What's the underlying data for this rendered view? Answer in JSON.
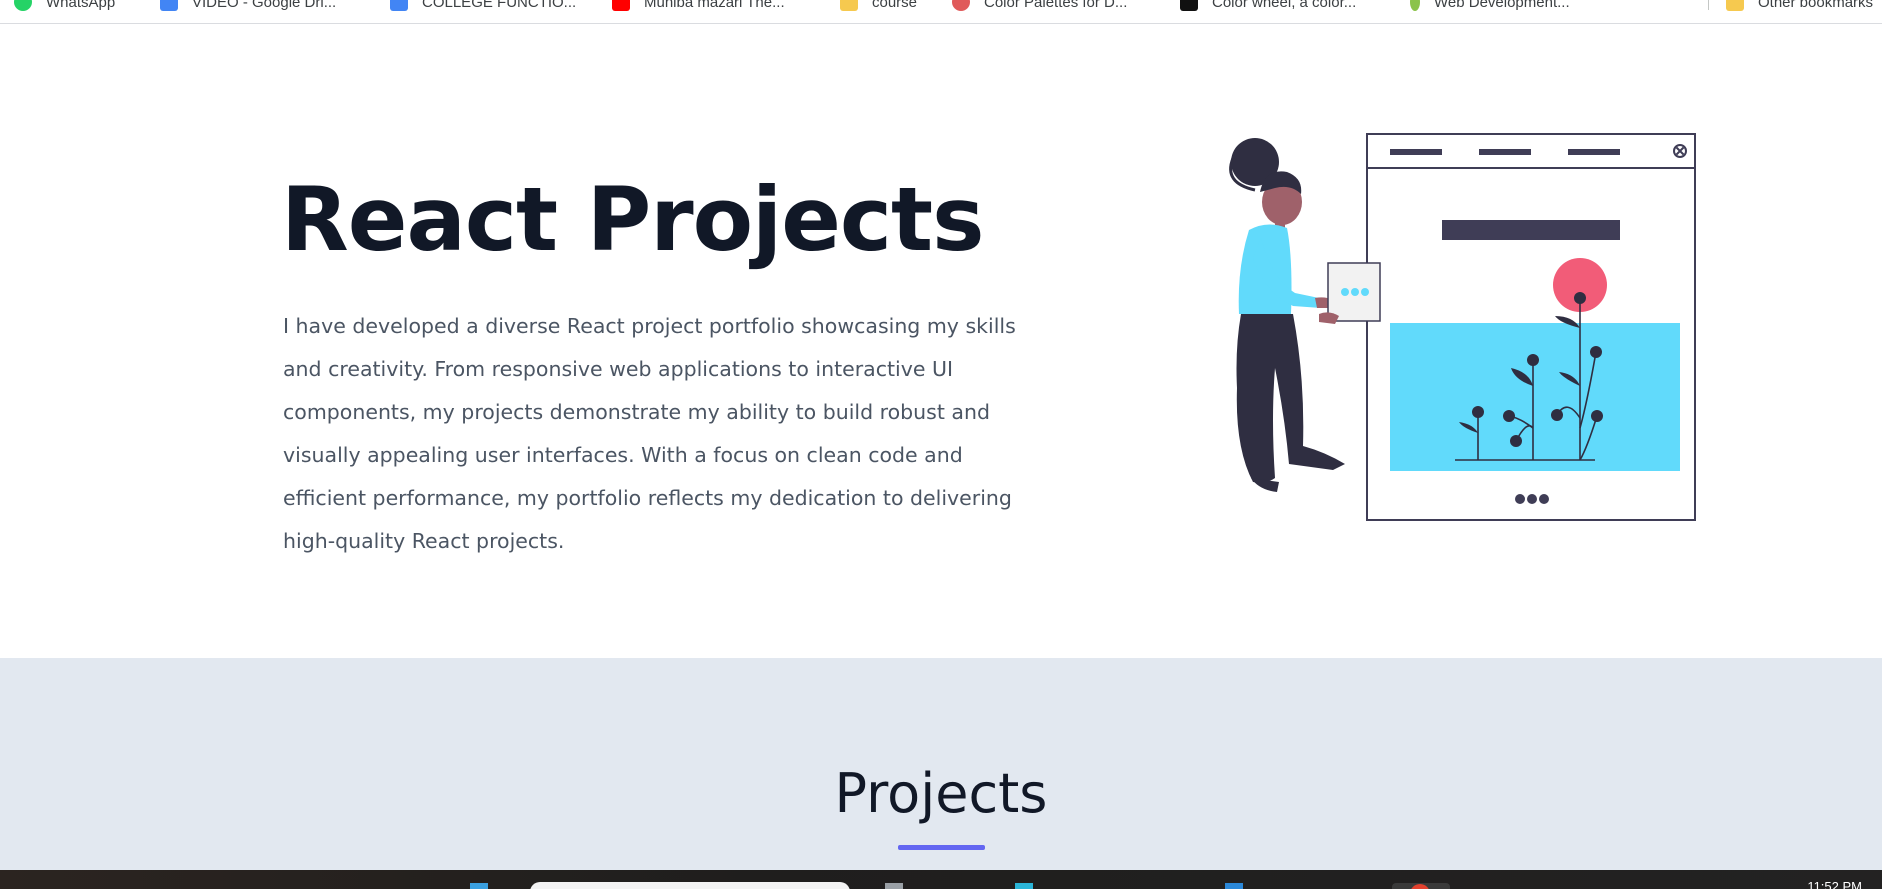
{
  "bookmarks": [
    {
      "label": "WhatsApp",
      "icon": "whatsapp-icon",
      "color": "#25d366"
    },
    {
      "label": "VIDEO - Google Dri...",
      "icon": "google-drive-icon",
      "color": "#4285f4"
    },
    {
      "label": "COLLEGE FUNCTIO...",
      "icon": "google-drive-icon",
      "color": "#4285f4"
    },
    {
      "label": "Muniba mazari The...",
      "icon": "youtube-icon",
      "color": "#ff0000"
    },
    {
      "label": "course",
      "icon": "folder-icon",
      "color": "#f6c94f"
    },
    {
      "label": "Color Palettes for D...",
      "icon": "palette-icon",
      "color": "#e05a5a"
    },
    {
      "label": "Color wheel, a color...",
      "icon": "canva-icon",
      "color": "#111111"
    },
    {
      "label": "Web Development...",
      "icon": "web-dev-icon",
      "color": "#8bc34a"
    },
    {
      "label": "Other bookmarks",
      "icon": "folder-icon",
      "color": "#f6c94f"
    }
  ],
  "hero": {
    "title": "React Projects",
    "description": "I have developed a diverse React project portfolio showcasing my skills and creativity. From responsive web applications to interactive UI components, my projects demonstrate my ability to build robust and visually appealing user interfaces. With a focus on clean code and efficient performance, my portfolio reflects my dedication to delivering high-quality React projects."
  },
  "projects": {
    "title": "Projects"
  },
  "taskbar": {
    "clock": "11:52 PM"
  },
  "colors": {
    "accent": "#6366f1",
    "cyan": "#61dafb",
    "pink": "#f25c78",
    "dark": "#2f2e41",
    "section_bg": "#e2e8f0"
  }
}
